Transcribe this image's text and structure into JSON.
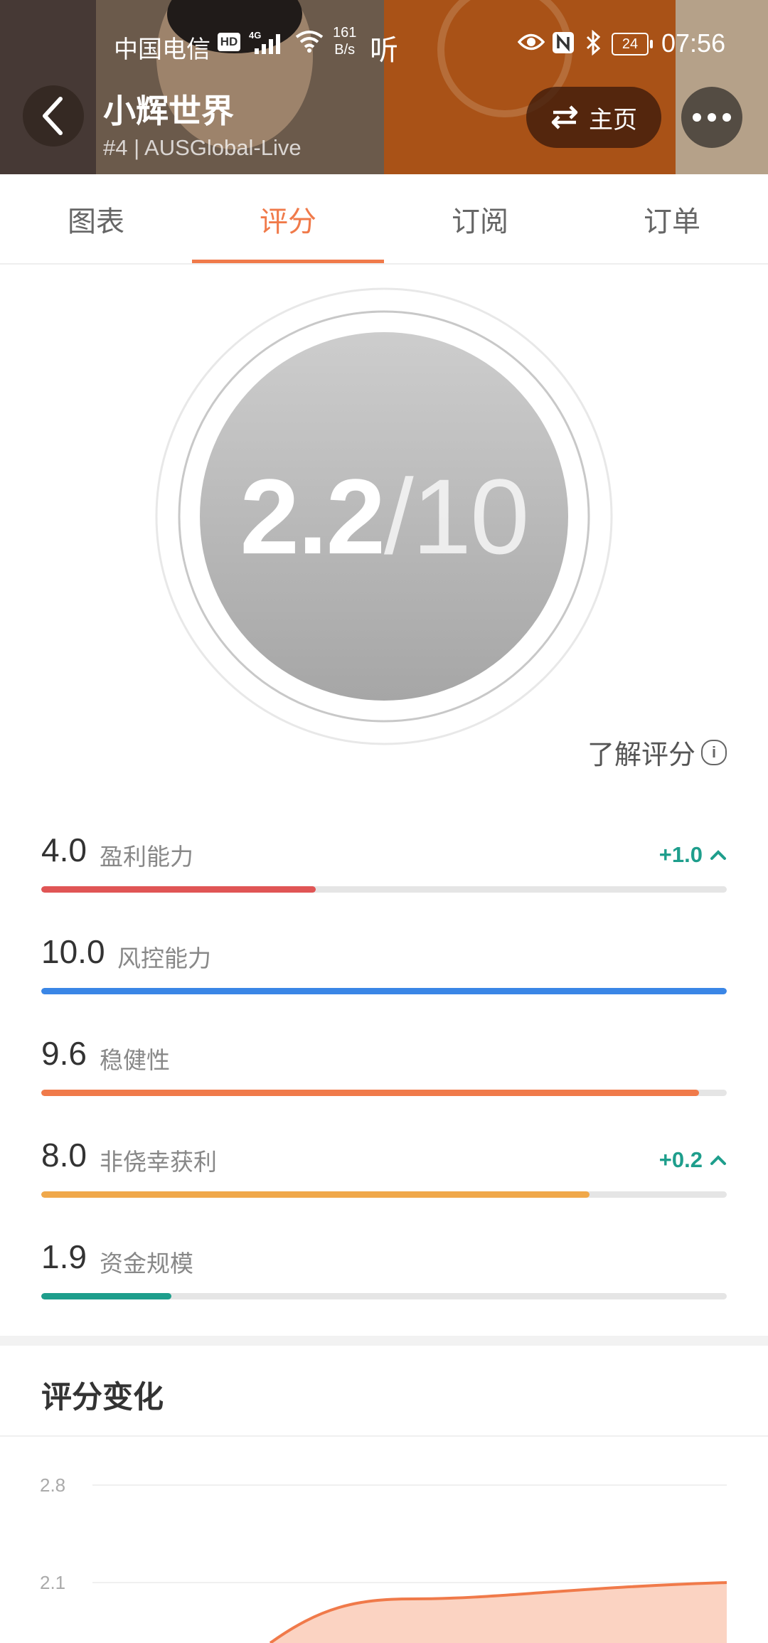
{
  "status_bar": {
    "carrier": "中国电信",
    "hd": "HD",
    "network_type": "4G",
    "speed_value": "161",
    "speed_unit": "B/s",
    "listen": "听",
    "battery": "24",
    "time": "07:56"
  },
  "header": {
    "title": "小辉世界",
    "subtitle": "#4 | AUSGlobal-Live",
    "home_button_label": "主页"
  },
  "tabs": [
    {
      "label": "图表",
      "active": false
    },
    {
      "label": "评分",
      "active": true
    },
    {
      "label": "订阅",
      "active": false
    },
    {
      "label": "订单",
      "active": false
    }
  ],
  "score": {
    "value": "2.2",
    "max_text": "/10"
  },
  "understand_link": "了解评分",
  "metrics": [
    {
      "value": "4.0",
      "label": "盈利能力",
      "fraction": 0.4,
      "color": "#e05555",
      "change": "+1.0"
    },
    {
      "value": "10.0",
      "label": "风控能力",
      "fraction": 1.0,
      "color": "#3a86e6",
      "change": ""
    },
    {
      "value": "9.6",
      "label": "稳健性",
      "fraction": 0.96,
      "color": "#f07a4a",
      "change": ""
    },
    {
      "value": "8.0",
      "label": "非侥幸获利",
      "fraction": 0.8,
      "color": "#f0a84a",
      "change": "+0.2"
    },
    {
      "value": "1.9",
      "label": "资金规模",
      "fraction": 0.19,
      "color": "#1e9e8c",
      "change": ""
    }
  ],
  "change_color": "#1e9e8c",
  "section": {
    "title": "评分变化"
  },
  "chart_data": {
    "type": "area",
    "y_ticks": [
      "2.8",
      "2.1"
    ],
    "series_color": "#f07a4a",
    "fill_color": "#fbd3c2"
  }
}
